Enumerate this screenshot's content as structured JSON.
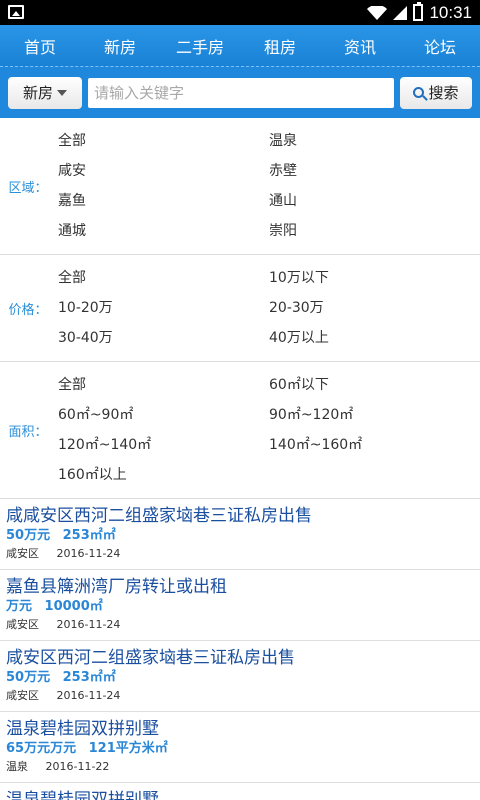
{
  "status": {
    "time": "10:31"
  },
  "nav": {
    "items": [
      "首页",
      "新房",
      "二手房",
      "租房",
      "资讯",
      "论坛"
    ]
  },
  "search": {
    "category": "新房",
    "placeholder": "请输入关键字",
    "button": "搜索"
  },
  "filters": [
    {
      "label": "区域：",
      "options": [
        "全部",
        "温泉",
        "咸安",
        "赤壁",
        "嘉鱼",
        "通山",
        "通城",
        "崇阳"
      ]
    },
    {
      "label": "价格：",
      "options": [
        "全部",
        "10万以下",
        "10-20万",
        "20-30万",
        "30-40万",
        "40万以上"
      ]
    },
    {
      "label": "面积：",
      "options": [
        "全部",
        "60㎡以下",
        "60㎡~90㎡",
        "90㎡~120㎡",
        "120㎡~140㎡",
        "140㎡~160㎡",
        "160㎡以上"
      ]
    }
  ],
  "listings": [
    {
      "title": "咸咸安区西河二组盛家垴巷三证私房出售",
      "price": "50万元",
      "area": "253㎡㎡",
      "district": "咸安区",
      "date": "2016-11-24"
    },
    {
      "title": "嘉鱼县簰洲湾厂房转让或出租",
      "price": "万元",
      "area": "10000㎡",
      "district": "咸安区",
      "date": "2016-11-24"
    },
    {
      "title": "咸安区西河二组盛家垴巷三证私房出售",
      "price": "50万元",
      "area": "253㎡㎡",
      "district": "咸安区",
      "date": "2016-11-24"
    },
    {
      "title": "温泉碧桂园双拼别墅",
      "price": "65万元万元",
      "area": "121平方米㎡",
      "district": "温泉",
      "date": "2016-11-22"
    },
    {
      "title": "温泉碧桂园双拼别墅",
      "price": "",
      "area": "",
      "district": "",
      "date": ""
    }
  ]
}
